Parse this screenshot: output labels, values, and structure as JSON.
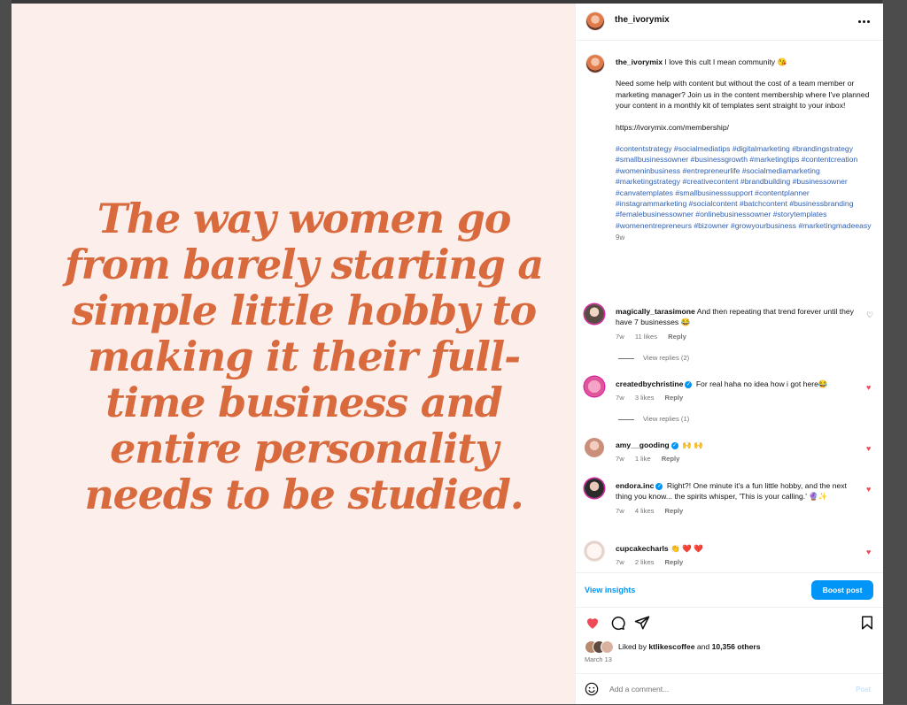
{
  "image": {
    "quote": "The way women go from barely starting a simple little hobby to making it their full-time business and entire personality needs to be studied.",
    "quote_color": "#d96a3e",
    "background": "#fbeeeb"
  },
  "header": {
    "username": "the_ivorymix",
    "more_icon": "more-horizontal-icon"
  },
  "caption": {
    "username": "the_ivorymix",
    "text": "I love this cult I mean community 😘",
    "body": "Need some help with content but without the cost of a team member or marketing manager? Join us in the content membership where I've planned your content in a monthly kit of templates sent straight to your inbox!",
    "link": "https://ivorymix.com/membership/",
    "hashtags": "#contentstrategy #socialmediatips #digitalmarketing #brandingstrategy #smallbusinessowner #businessgrowth #marketingtips #contentcreation #womeninbusiness #entrepreneurlife #socialmediamarketing #marketingstrategy #creativecontent #brandbuilding #businessowner #canvatemplates #smallbusinesssupport #contentplanner #instagrammarketing #socialcontent #batchcontent #businessbranding #femalebusinessowner #onlinebusinessowner #storytemplates #womenentrepreneurs #bizowner #growyourbusiness #marketingmadeeasy",
    "time": "9w"
  },
  "comments": [
    {
      "username": "magically_tarasimone",
      "text": "And then repeating that trend forever until they have 7 businesses 😂",
      "time": "7w",
      "likes": "11 likes",
      "reply": "Reply",
      "liked": false,
      "replies": "View replies (2)",
      "verified": false
    },
    {
      "username": "createdbychristine",
      "text": "For real haha no idea how i got here😂",
      "time": "7w",
      "likes": "3 likes",
      "reply": "Reply",
      "liked": true,
      "replies": "View replies (1)",
      "verified": true
    },
    {
      "username": "amy__gooding",
      "text": "🙌 🙌",
      "time": "7w",
      "likes": "1 like",
      "reply": "Reply",
      "liked": true,
      "verified": true
    },
    {
      "username": "endora.inc",
      "text": "Right?! One minute it's a fun little hobby, and the next thing you know... the spirits whisper, 'This is your calling.' 🔮✨",
      "time": "7w",
      "likes": "4 likes",
      "reply": "Reply",
      "liked": true,
      "verified": true
    },
    {
      "username": "cupcakecharls",
      "text": "👏 ❤️ ❤️",
      "time": "7w",
      "likes": "2 likes",
      "reply": "Reply",
      "liked": true,
      "verified": false
    }
  ],
  "insights": {
    "view_label": "View insights",
    "boost_label": "Boost post"
  },
  "actions": [
    "heart-filled-icon",
    "comment-icon",
    "share-icon",
    "bookmark-icon"
  ],
  "likes": {
    "prefix": "Liked by",
    "user": "ktlikescoffee",
    "middle": "and",
    "others": "10,356 others"
  },
  "date": "March 13",
  "comment_box": {
    "placeholder": "Add a comment...",
    "post_label": "Post"
  },
  "colors": {
    "accent": "#0095f6",
    "heart": "#ed4956",
    "hashtag": "#2f5fb3"
  }
}
